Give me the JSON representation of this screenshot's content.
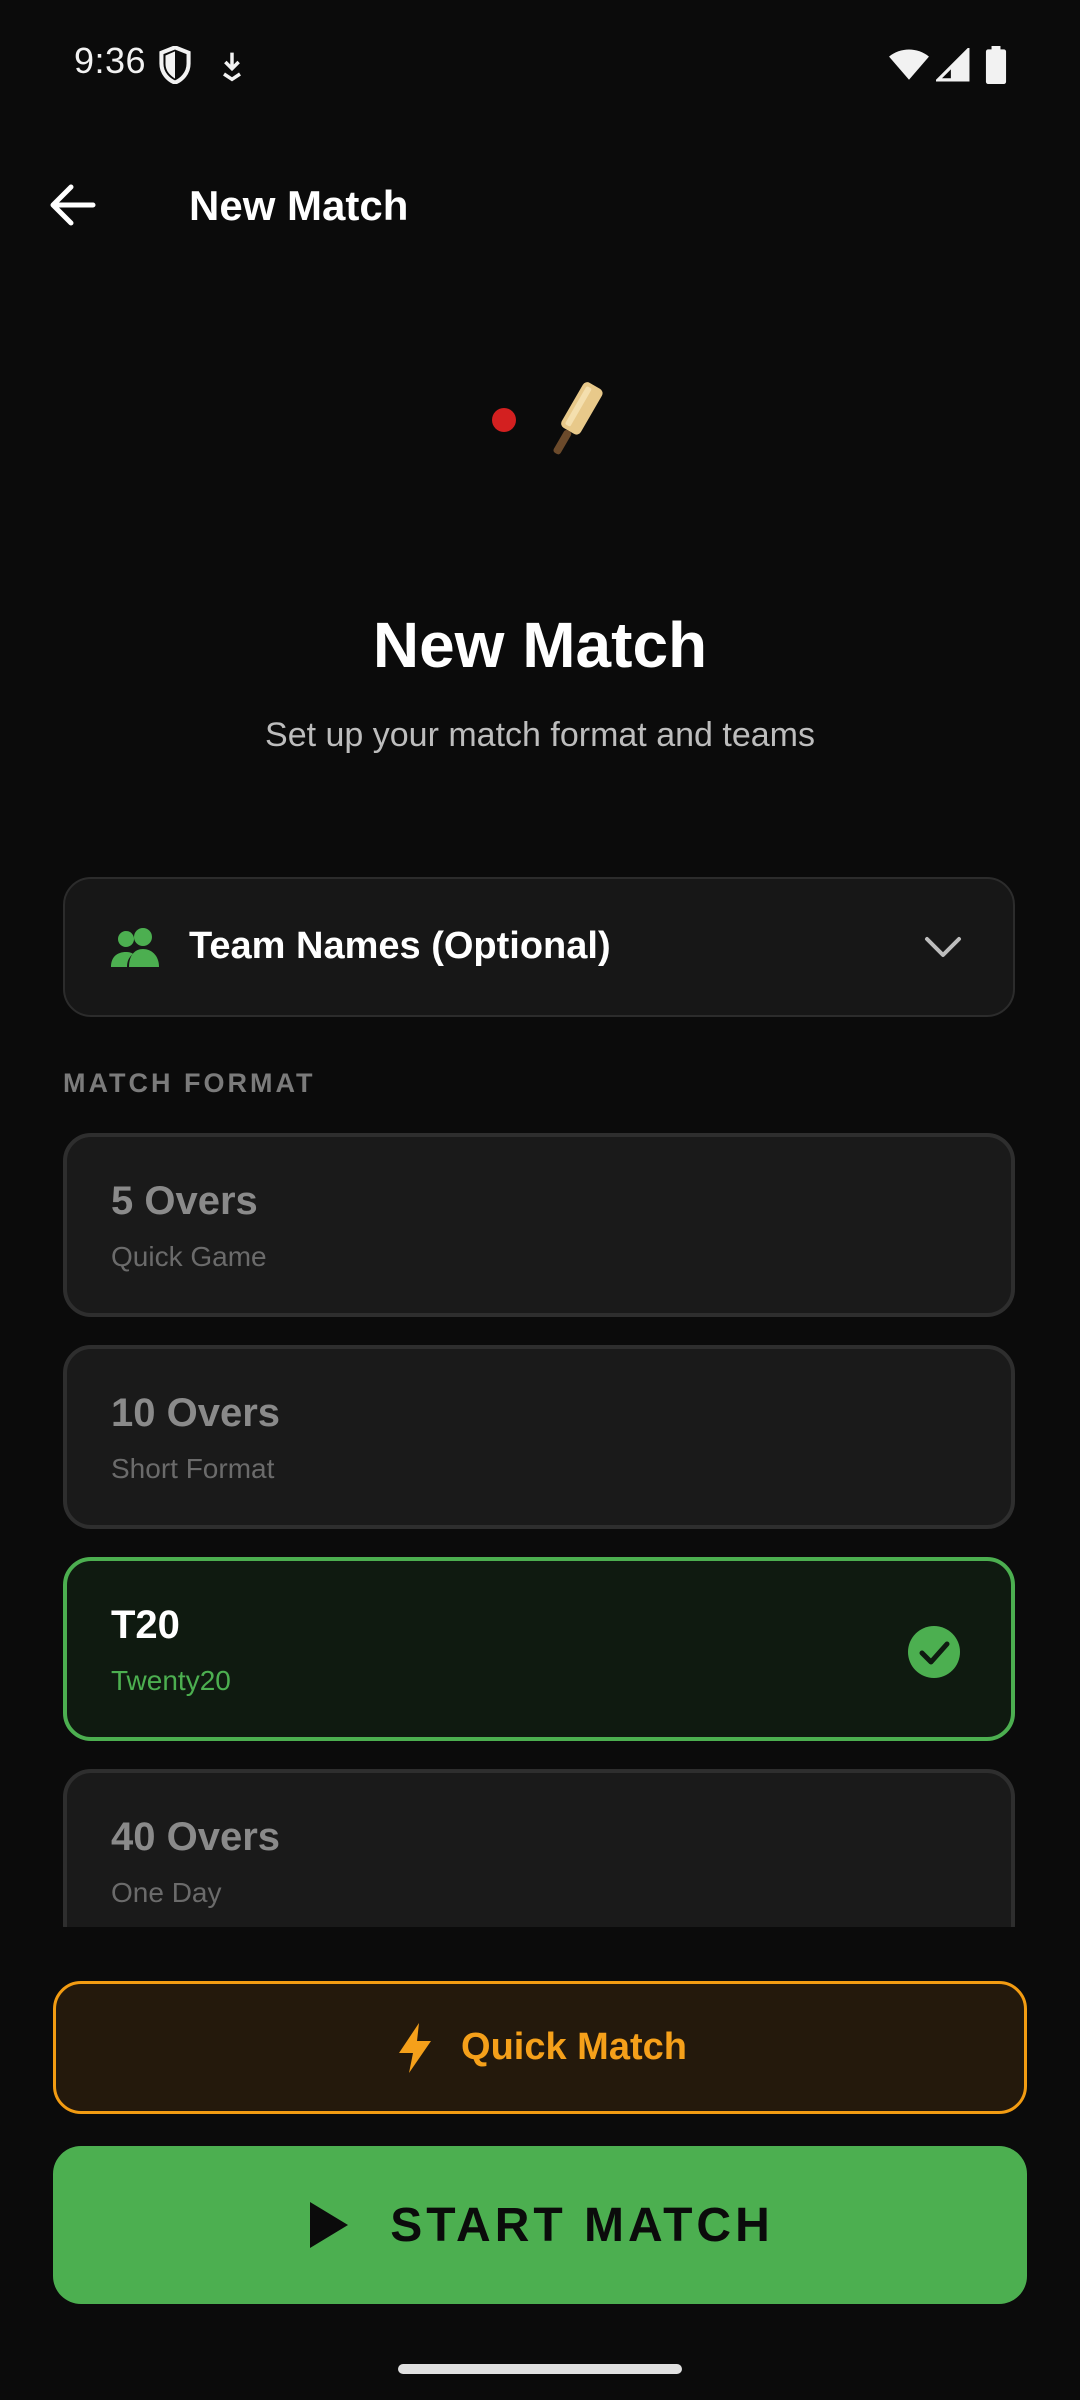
{
  "status_bar": {
    "time": "9:36",
    "icons": [
      "shield-icon",
      "download-icon",
      "wifi-icon",
      "signal-icon",
      "battery-icon"
    ]
  },
  "app_bar": {
    "back_icon": "arrow-left-icon",
    "title": "New Match"
  },
  "hero": {
    "icon": "cricket-bat-ball-icon",
    "title": "New Match",
    "subtitle": "Set up your match format and teams"
  },
  "team_names": {
    "icon": "group-icon",
    "label": "Team Names (Optional)",
    "chevron_icon": "chevron-down-icon",
    "expanded": false
  },
  "match_format": {
    "section_label": "MATCH FORMAT",
    "options": [
      {
        "name": "5 Overs",
        "description": "Quick Game",
        "selected": false
      },
      {
        "name": "10 Overs",
        "description": "Short Format",
        "selected": false
      },
      {
        "name": "T20",
        "description": "Twenty20",
        "selected": true
      },
      {
        "name": "40 Overs",
        "description": "One Day",
        "selected": false
      }
    ]
  },
  "actions": {
    "quick_match_label": "Quick Match",
    "quick_match_icon": "bolt-icon",
    "start_match_label": "START MATCH",
    "start_match_icon": "play-icon"
  },
  "colors": {
    "background": "#0b0b0b",
    "accent_green": "#4caf50",
    "accent_orange": "#f39c12",
    "card": "#1a1a1a"
  }
}
